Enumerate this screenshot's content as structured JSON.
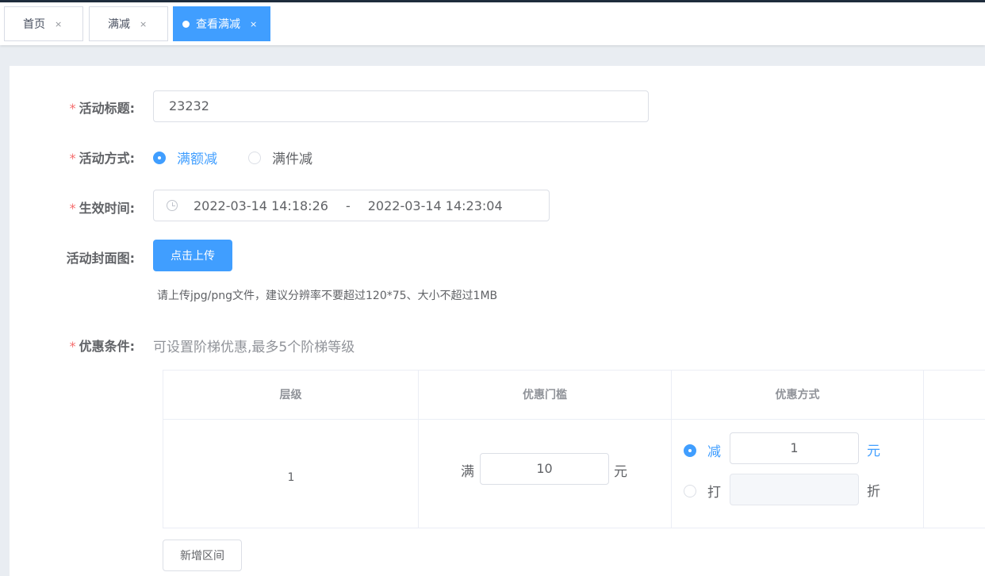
{
  "tabs": [
    {
      "label": "首页",
      "close": "×",
      "active": false
    },
    {
      "label": "满减",
      "close": "×",
      "active": false
    },
    {
      "label": "查看满减",
      "close": "×",
      "active": true
    }
  ],
  "form": {
    "title": {
      "required_mark": "*",
      "label": "活动标题:",
      "value": "23232"
    },
    "mode": {
      "required_mark": "*",
      "label": "活动方式:",
      "options": [
        {
          "label": "满额减",
          "checked": true
        },
        {
          "label": "满件减",
          "checked": false
        }
      ]
    },
    "time": {
      "required_mark": "*",
      "label": "生效时间:",
      "start": "2022-03-14 14:18:26",
      "separator": "-",
      "end": "2022-03-14 14:23:04"
    },
    "cover": {
      "label": "活动封面图:",
      "upload_button": "点击上传",
      "tip": "请上传jpg/png文件，建议分辨率不要超过120*75、大小不超过1MB"
    },
    "conditions": {
      "required_mark": "*",
      "label": "优惠条件:",
      "tip": "可设置阶梯优惠,最多5个阶梯等级"
    }
  },
  "table": {
    "headers": [
      "层级",
      "优惠门槛",
      "优惠方式",
      ""
    ],
    "rows": [
      {
        "level": "1",
        "threshold_prefix": "满",
        "threshold_value": "10",
        "threshold_unit": "元",
        "discount_options": [
          {
            "label": "减",
            "value": "1",
            "unit": "元",
            "checked": true
          },
          {
            "label": "打",
            "value": "",
            "unit": "折",
            "checked": false
          }
        ]
      }
    ]
  },
  "add_range_button": "新增区间",
  "colors": {
    "accent": "#409eff",
    "required": "#f56c6c",
    "header_dark": "#1f2d3d"
  }
}
